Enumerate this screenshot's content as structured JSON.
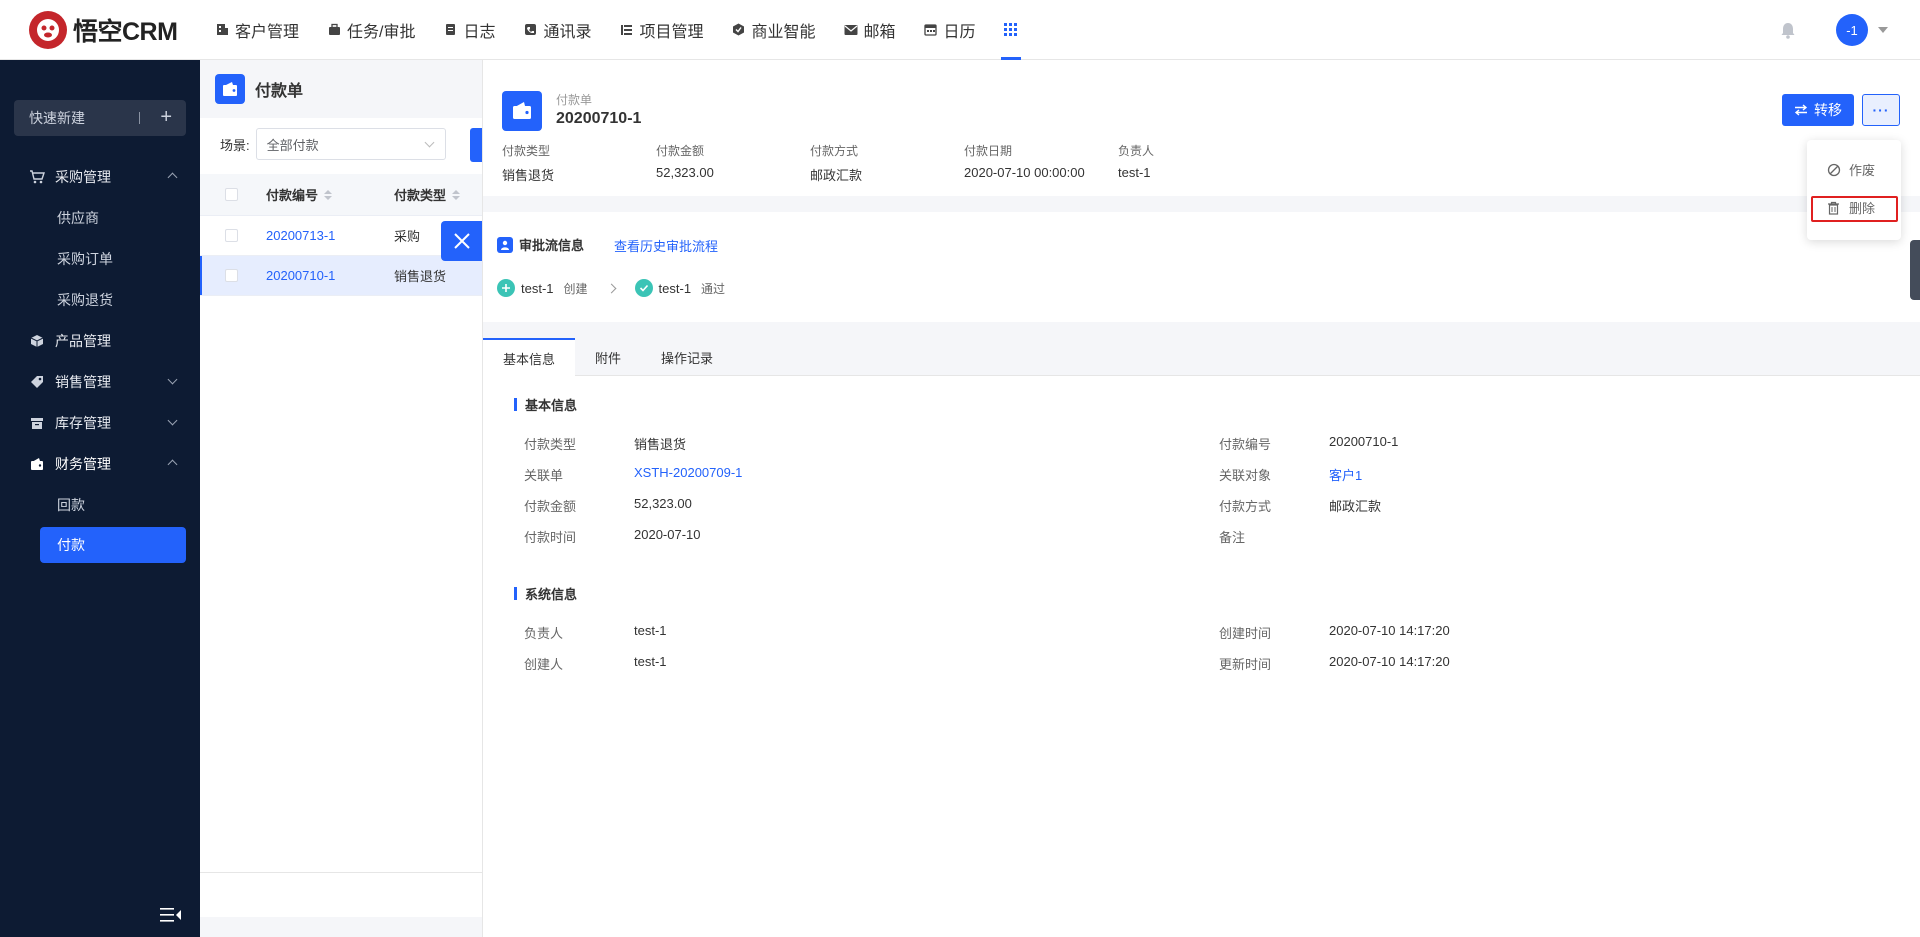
{
  "app": {
    "logo_text": "悟空CRM"
  },
  "nav": {
    "items": [
      {
        "label": "客户管理",
        "icon": "building-icon"
      },
      {
        "label": "任务/审批",
        "icon": "briefcase-icon"
      },
      {
        "label": "日志",
        "icon": "notebook-icon"
      },
      {
        "label": "通讯录",
        "icon": "phone-book-icon"
      },
      {
        "label": "项目管理",
        "icon": "project-icon"
      },
      {
        "label": "商业智能",
        "icon": "bi-icon"
      },
      {
        "label": "邮箱",
        "icon": "mail-icon"
      },
      {
        "label": "日历",
        "icon": "calendar-icon"
      }
    ],
    "user_avatar": "-1"
  },
  "sidebar": {
    "quick_new": "快速新建",
    "menu": {
      "purchase": "采购管理",
      "supplier": "供应商",
      "purchase_order": "采购订单",
      "purchase_return": "采购退货",
      "product": "产品管理",
      "sales": "销售管理",
      "inventory": "库存管理",
      "finance": "财务管理",
      "receipt": "回款",
      "payment": "付款"
    }
  },
  "list": {
    "title": "付款单",
    "scene_label": "场景:",
    "scene_value": "全部付款",
    "columns": [
      "付款编号",
      "付款类型"
    ],
    "rows": [
      {
        "no": "20200713-1",
        "type": "采购"
      },
      {
        "no": "20200710-1",
        "type": "销售退货"
      }
    ]
  },
  "detail": {
    "subtitle": "付款单",
    "name": "20200710-1",
    "transfer_label": "转移",
    "more_label": "···",
    "summary": [
      {
        "k": "付款类型",
        "v": "销售退货"
      },
      {
        "k": "付款金额",
        "v": "52,323.00"
      },
      {
        "k": "付款方式",
        "v": "邮政汇款"
      },
      {
        "k": "付款日期",
        "v": "2020-07-10 00:00:00"
      },
      {
        "k": "负责人",
        "v": "test-1"
      }
    ],
    "approval": {
      "title": "审批流信息",
      "history_link": "查看历史审批流程",
      "steps": [
        {
          "who": "test-1",
          "action": "创建"
        },
        {
          "who": "test-1",
          "action": "通过"
        }
      ]
    },
    "tabs": [
      "基本信息",
      "附件",
      "操作记录"
    ],
    "basic": {
      "title": "基本信息",
      "left": [
        {
          "k": "付款类型",
          "v": "销售退货"
        },
        {
          "k": "关联单",
          "v": "XSTH-20200709-1"
        },
        {
          "k": "付款金额",
          "v": "52,323.00"
        },
        {
          "k": "付款时间",
          "v": "2020-07-10"
        }
      ],
      "right": [
        {
          "k": "付款编号",
          "v": "20200710-1"
        },
        {
          "k": "关联对象",
          "v": "客户1"
        },
        {
          "k": "付款方式",
          "v": "邮政汇款"
        },
        {
          "k": "备注",
          "v": ""
        }
      ]
    },
    "system": {
      "title": "系统信息",
      "left": [
        {
          "k": "负责人",
          "v": "test-1"
        },
        {
          "k": "创建人",
          "v": "test-1"
        }
      ],
      "right": [
        {
          "k": "创建时间",
          "v": "2020-07-10 14:17:20"
        },
        {
          "k": "更新时间",
          "v": "2020-07-10 14:17:20"
        }
      ]
    }
  },
  "dropdown": {
    "void": "作废",
    "delete": "删除"
  },
  "colors": {
    "accent": "#2362fb",
    "sidebar_bg": "#0d1b33",
    "highlight": "#e02020"
  }
}
